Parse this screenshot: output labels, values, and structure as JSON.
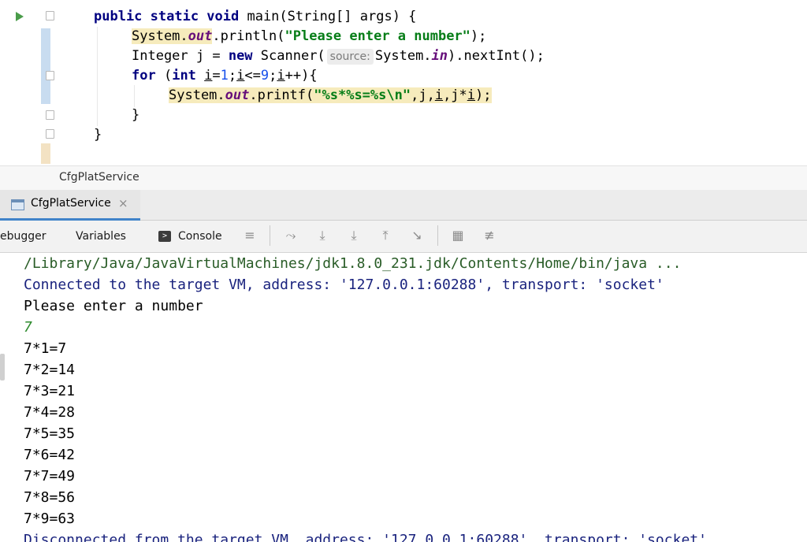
{
  "editor": {
    "lines": [
      [
        "public static void main(String[] args) {"
      ],
      [
        "System.out.println(\"Please enter a number\");"
      ],
      [
        "Integer j = new Scanner(",
        "source:",
        "System.in).nextInt();"
      ],
      [
        "for (int i=1;i<=9;i++){"
      ],
      [
        "System.out.printf(\"%s*%s=%s\\n\",j,i,j*i);"
      ],
      [
        "}"
      ],
      [
        "}"
      ]
    ]
  },
  "breadcrumb": {
    "label": "CfgPlatService"
  },
  "run_tab": {
    "label": "CfgPlatService",
    "close": "×"
  },
  "debug_tabs": {
    "debugger": "ebugger",
    "variables": "Variables",
    "console": "Console"
  },
  "toolbar_icons": [
    "menu-icon",
    "show-execution-point-icon",
    "step-over-icon",
    "step-into-icon",
    "step-out-icon",
    "run-to-cursor-icon",
    "evaluate-icon",
    "trace-icon"
  ],
  "console": {
    "lines": [
      {
        "text": "/Library/Java/JavaVirtualMachines/jdk1.8.0_231.jdk/Contents/Home/bin/java ...",
        "kind": "path"
      },
      {
        "text": "Connected to the target VM, address: '127.0.0.1:60288', transport: 'socket'",
        "kind": "sys"
      },
      {
        "text": "Please enter a number",
        "kind": "out"
      },
      {
        "text": "7",
        "kind": "in"
      },
      {
        "text": "7*1=7",
        "kind": "out"
      },
      {
        "text": "7*2=14",
        "kind": "out"
      },
      {
        "text": "7*3=21",
        "kind": "out"
      },
      {
        "text": "7*4=28",
        "kind": "out"
      },
      {
        "text": "7*5=35",
        "kind": "out"
      },
      {
        "text": "7*6=42",
        "kind": "out"
      },
      {
        "text": "7*7=49",
        "kind": "out"
      },
      {
        "text": "7*8=56",
        "kind": "out"
      },
      {
        "text": "7*9=63",
        "kind": "out"
      },
      {
        "text": "Disconnected from the target VM, address: '127.0.0.1:60288', transport: 'socket'",
        "kind": "sys"
      }
    ]
  },
  "colors": {
    "keyword": "#000080",
    "string": "#067d17",
    "field": "#660e7a",
    "number": "#1750eb",
    "accent": "#4083c9",
    "input": "#2e8b2e"
  }
}
